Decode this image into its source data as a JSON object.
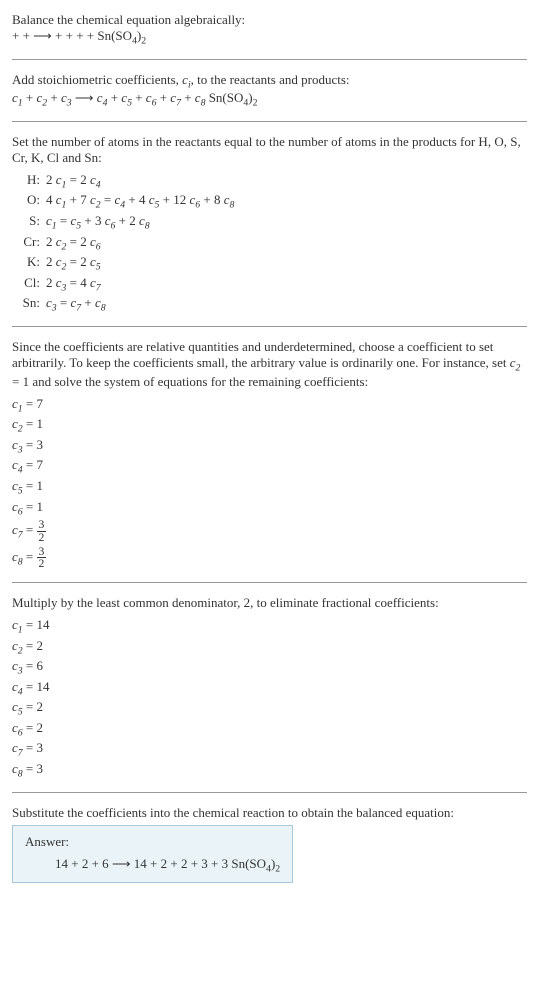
{
  "intro1": "Balance the chemical equation algebraically:",
  "intro1_eq": " +  +  ⟶  +  +  +  + Sn(SO4)2",
  "intro2_a": "Add stoichiometric coefficients, ",
  "intro2_b": ", to the reactants and products:",
  "intro2_eq_parts": {
    "c1": "c",
    "c1s": "1",
    "c2": "c",
    "c2s": "2",
    "c3": "c",
    "c3s": "3",
    "arrow": " ⟶ ",
    "c4": "c",
    "c4s": "4",
    "c5": "c",
    "c5s": "5",
    "c6": "c",
    "c6s": "6",
    "c7": "c",
    "c7s": "7",
    "c8": "c",
    "c8s": "8",
    "tail": " Sn(SO4)2"
  },
  "set_atoms": "Set the number of atoms in the reactants equal to the number of atoms in the products for H, O, S, Cr, K, Cl and Sn:",
  "atom_eqs": [
    {
      "label": "H:",
      "eq": "2 c1 = 2 c4"
    },
    {
      "label": "O:",
      "eq": "4 c1 + 7 c2 = c4 + 4 c5 + 12 c6 + 8 c8"
    },
    {
      "label": "S:",
      "eq": "c1 = c5 + 3 c6 + 2 c8"
    },
    {
      "label": "Cr:",
      "eq": "2 c2 = 2 c6"
    },
    {
      "label": "K:",
      "eq": "2 c2 = 2 c5"
    },
    {
      "label": "Cl:",
      "eq": "2 c3 = 4 c7"
    },
    {
      "label": "Sn:",
      "eq": "c3 = c7 + c8"
    }
  ],
  "since_text": "Since the coefficients are relative quantities and underdetermined, choose a coefficient to set arbitrarily. To keep the coefficients small, the arbitrary value is ordinarily one. For instance, set c2 = 1 and solve the system of equations for the remaining coefficients:",
  "coefs1": [
    {
      "k": "c1",
      "v": "7"
    },
    {
      "k": "c2",
      "v": "1"
    },
    {
      "k": "c3",
      "v": "3"
    },
    {
      "k": "c4",
      "v": "7"
    },
    {
      "k": "c5",
      "v": "1"
    },
    {
      "k": "c6",
      "v": "1"
    },
    {
      "k": "c7",
      "v": "3/2",
      "frac": true,
      "num": "3",
      "den": "2"
    },
    {
      "k": "c8",
      "v": "3/2",
      "frac": true,
      "num": "3",
      "den": "2"
    }
  ],
  "mult_text": "Multiply by the least common denominator, 2, to eliminate fractional coefficients:",
  "coefs2": [
    {
      "k": "c1",
      "v": "14"
    },
    {
      "k": "c2",
      "v": "2"
    },
    {
      "k": "c3",
      "v": "6"
    },
    {
      "k": "c4",
      "v": "14"
    },
    {
      "k": "c5",
      "v": "2"
    },
    {
      "k": "c6",
      "v": "2"
    },
    {
      "k": "c7",
      "v": "3"
    },
    {
      "k": "c8",
      "v": "3"
    }
  ],
  "subst_text": "Substitute the coefficients into the chemical reaction to obtain the balanced equation:",
  "answer_label": "Answer:",
  "answer_eq": "14  + 2  + 6  ⟶ 14  + 2  + 2  + 3  + 3 Sn(SO4)2"
}
